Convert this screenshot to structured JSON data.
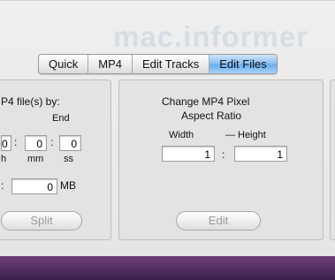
{
  "watermark": "mac.informer",
  "tabs": [
    {
      "label": "Quick"
    },
    {
      "label": "MP4"
    },
    {
      "label": "Edit Tracks"
    },
    {
      "label": "Edit Files"
    }
  ],
  "split_panel": {
    "title": "P4 file(s) by:",
    "end_label": "End",
    "time_values": [
      "0",
      "0",
      "0"
    ],
    "units": [
      "h",
      "mm",
      "ss"
    ],
    "size_value": "0",
    "size_unit": "MB",
    "button": "Split"
  },
  "aspect_panel": {
    "title_line1": "Change MP4 Pixel",
    "title_line2": "Aspect Ratio",
    "width_label": "Width",
    "height_label": "Height",
    "width_value": "1",
    "height_value": "1",
    "separator": ":",
    "button": "Edit"
  }
}
